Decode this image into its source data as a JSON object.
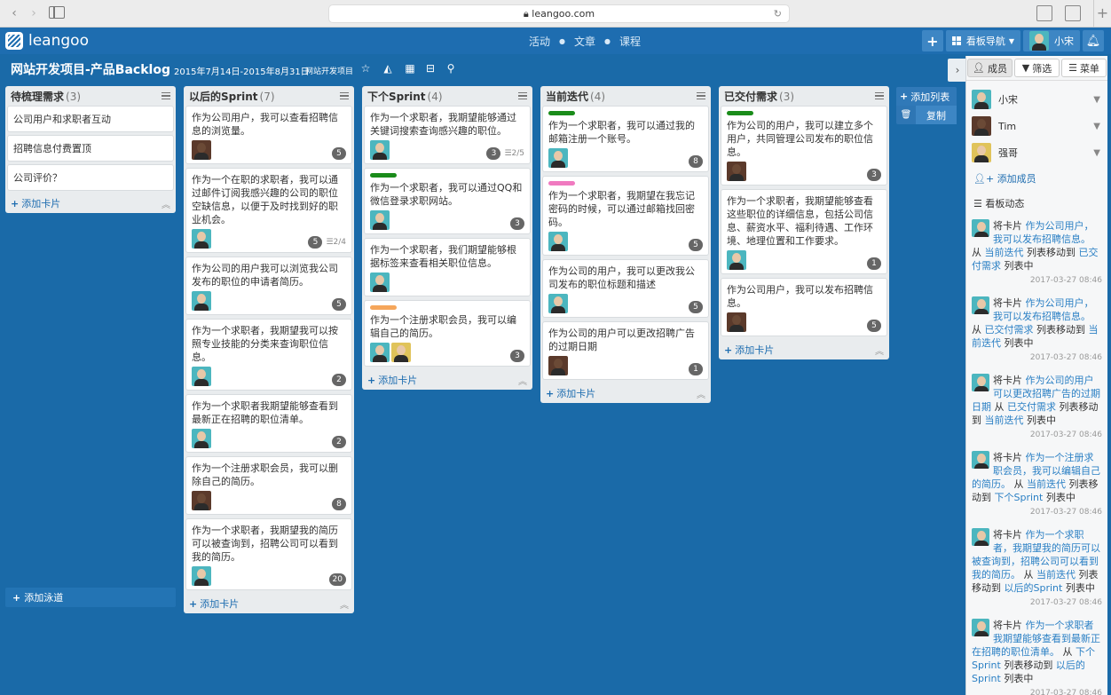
{
  "browser": {
    "url": "leangoo.com"
  },
  "app": {
    "logo_text": "leangoo",
    "nav_links": [
      "活动",
      "文章",
      "课程"
    ],
    "board_nav_label": "看板导航",
    "user_name": "小宋"
  },
  "project": {
    "title": "网站开发项目-产品Backlog",
    "dates": "2015年7月14日-2015年8月31日",
    "tag": "网站开发项目"
  },
  "lists": [
    {
      "title": "待梳理需求",
      "count": "(3)",
      "simple_cards": [
        "公司用户和求职者互动",
        "招聘信息付费置顶",
        "公司评价？"
      ],
      "add_label": "添加卡片"
    },
    {
      "title": "以后的Sprint",
      "count": "(7)",
      "cards": [
        {
          "text": "作为公司用户，我可以查看招聘信息的浏览量。",
          "badge": "5",
          "checklist": "",
          "label": "",
          "avatars": [
            "dark"
          ]
        },
        {
          "text": "作为一个在职的求职者，我可以通过邮件订阅我感兴趣的公司的职位空缺信息，以便于及时找到好的职业机会。",
          "badge": "5",
          "checklist": "2/4",
          "label": "",
          "avatars": [
            "teal"
          ]
        },
        {
          "text": "作为公司的用户我可以浏览我公司发布的职位的申请者简历。",
          "badge": "5",
          "checklist": "",
          "label": "",
          "avatars": [
            "teal"
          ]
        },
        {
          "text": "作为一个求职者，我期望我可以按照专业技能的分类来查询职位信息。",
          "badge": "2",
          "checklist": "",
          "label": "",
          "avatars": [
            "teal"
          ]
        },
        {
          "text": "作为一个求职者我期望能够查看到最新正在招聘的职位清单。",
          "badge": "2",
          "checklist": "",
          "label": "",
          "avatars": [
            "teal"
          ]
        },
        {
          "text": "作为一个注册求职会员，我可以删除自己的简历。",
          "badge": "8",
          "checklist": "",
          "label": "",
          "avatars": [
            "dark"
          ]
        },
        {
          "text": "作为一个求职者，我期望我的简历可以被查询到，招聘公司可以看到我的简历。",
          "badge": "20",
          "checklist": "",
          "label": "",
          "avatars": [
            "teal"
          ]
        }
      ],
      "add_label": "添加卡片"
    },
    {
      "title": "下个Sprint",
      "count": "(4)",
      "cards": [
        {
          "text": "作为一个求职者，我期望能够通过关键词搜索查询感兴趣的职位。",
          "badge": "3",
          "checklist": "2/5",
          "label": "",
          "avatars": [
            "teal"
          ]
        },
        {
          "text": "作为一个求职者，我可以通过QQ和微信登录求职网站。",
          "badge": "3",
          "checklist": "",
          "label": "#1a8c1a",
          "avatars": [
            "teal"
          ]
        },
        {
          "text": "作为一个求职者，我们期望能够根据标签来查看相关职位信息。",
          "badge": "",
          "checklist": "",
          "label": "",
          "avatars": [
            "teal"
          ]
        },
        {
          "text": "作为一个注册求职会员，我可以编辑自己的简历。",
          "badge": "3",
          "checklist": "",
          "label": "#f5a65b",
          "avatars": [
            "teal",
            "gold"
          ]
        }
      ],
      "add_label": "添加卡片"
    },
    {
      "title": "当前迭代",
      "count": "(4)",
      "cards": [
        {
          "text": "作为一个求职者，我可以通过我的邮箱注册一个账号。",
          "badge": "8",
          "checklist": "",
          "label": "#1a8c1a",
          "avatars": [
            "teal"
          ]
        },
        {
          "text": "作为一个求职者，我期望在我忘记密码的时候，可以通过邮箱找回密码。",
          "badge": "5",
          "checklist": "",
          "label": "#f07ac0",
          "avatars": [
            "teal"
          ]
        },
        {
          "text": "作为公司的用户，我可以更改我公司发布的职位标题和描述",
          "badge": "5",
          "checklist": "",
          "label": "",
          "avatars": [
            "teal"
          ]
        },
        {
          "text": "作为公司的用户可以更改招聘广告的过期日期",
          "badge": "1",
          "checklist": "",
          "label": "",
          "avatars": [
            "dark"
          ]
        }
      ],
      "add_label": "添加卡片"
    },
    {
      "title": "已交付需求",
      "count": "(3)",
      "cards": [
        {
          "text": "作为公司的用户，我可以建立多个用户，共同管理公司发布的职位信息。",
          "badge": "3",
          "checklist": "",
          "label": "#1a8c1a",
          "avatars": [
            "dark"
          ]
        },
        {
          "text": "作为一个求职者，我期望能够查看这些职位的详细信息，包括公司信息、薪资水平、福利待遇、工作环境、地理位置和工作要求。",
          "badge": "1",
          "checklist": "",
          "label": "",
          "avatars": [
            "teal"
          ]
        },
        {
          "text": "作为公司用户，我可以发布招聘信息。",
          "badge": "5",
          "checklist": "",
          "label": "",
          "avatars": [
            "dark"
          ]
        }
      ],
      "add_label": "添加卡片"
    }
  ],
  "add_list": {
    "label": "添加列表",
    "copy": "复制"
  },
  "swimlane": {
    "label": "添加泳道"
  },
  "panel": {
    "tabs": [
      "成员",
      "筛选",
      "菜单"
    ],
    "members": [
      {
        "name": "小宋",
        "color": "teal"
      },
      {
        "name": "Tim",
        "color": "dark"
      },
      {
        "name": "强哥",
        "color": "gold"
      }
    ],
    "add_member": "添加成员",
    "activity_title": "看板动态",
    "activities": [
      {
        "pre": "将卡片 ",
        "card": "作为公司用户，我可以发布招聘信息。",
        "from_word": " 从 ",
        "from": "当前迭代",
        "to_word": " 列表移动到 ",
        "to": "已交付需求",
        "end": " 列表中",
        "time": "2017-03-27 08:46"
      },
      {
        "pre": "将卡片 ",
        "card": "作为公司用户，我可以发布招聘信息。",
        "from_word": " 从 ",
        "from": "已交付需求",
        "to_word": " 列表移动到 ",
        "to": "当前迭代",
        "end": " 列表中",
        "time": "2017-03-27 08:46"
      },
      {
        "pre": "将卡片 ",
        "card": "作为公司的用户可以更改招聘广告的过期日期",
        "from_word": " 从 ",
        "from": "已交付需求",
        "to_word": " 列表移动到 ",
        "to": "当前迭代",
        "end": " 列表中",
        "time": "2017-03-27 08:46"
      },
      {
        "pre": "将卡片 ",
        "card": "作为一个注册求职会员，我可以编辑自己的简历。",
        "from_word": " 从 ",
        "from": "当前迭代",
        "to_word": " 列表移动到 ",
        "to": "下个Sprint",
        "end": " 列表中",
        "time": "2017-03-27 08:46"
      },
      {
        "pre": "将卡片 ",
        "card": "作为一个求职者，我期望我的简历可以被查询到，招聘公司可以看到我的简历。",
        "from_word": " 从 ",
        "from": "当前迭代",
        "to_word": " 列表移动到 ",
        "to": "以后的Sprint",
        "end": " 列表中",
        "time": "2017-03-27 08:46"
      },
      {
        "pre": "将卡片 ",
        "card": "作为一个求职者我期望能够查看到最新正在招聘的职位清单。",
        "from_word": " 从 ",
        "from": "下个Sprint",
        "to_word": " 列表移动到 ",
        "to": "以后的Sprint",
        "end": " 列表中",
        "time": "2017-03-27 08:46"
      }
    ]
  }
}
